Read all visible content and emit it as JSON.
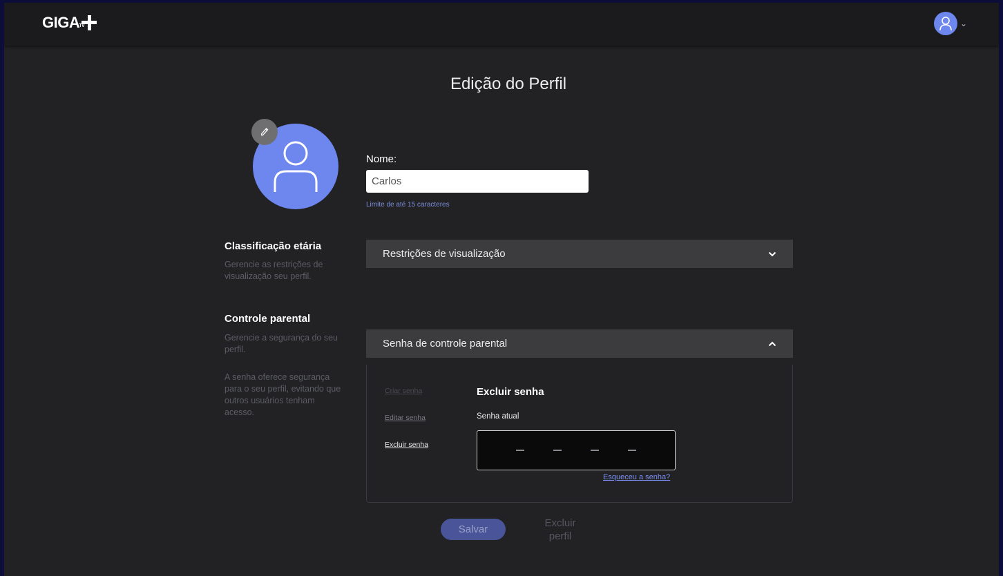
{
  "header": {
    "logo_text": "GIGA",
    "logo_sub": "TV",
    "account_caret": "⌄"
  },
  "page": {
    "title": "Edição do Perfil"
  },
  "profile": {
    "name_label": "Nome:",
    "name_value": "Carlos",
    "name_hint": "Limite de até 15 caracteres"
  },
  "age_rating": {
    "title": "Classificação etária",
    "description": "Gerencie as restrições de visualização seu perfil.",
    "accordion_label": "Restrições de visualização"
  },
  "parental": {
    "title": "Controle parental",
    "description": "Gerencie a segurança do seu perfil.",
    "note": "A senha oferece segurança para o seu perfil, evitando que outros usuários tenham acesso.",
    "accordion_label": "Senha de controle parental",
    "options": [
      {
        "label": "Criar senha",
        "color": "#4a4a52"
      },
      {
        "label": "Editar senha",
        "color": "#7a7a84"
      },
      {
        "label": "Excluir senha",
        "color": "#e8e8e8"
      }
    ],
    "panel_title": "Excluir senha",
    "current_password_label": "Senha atual",
    "forgot_link": "Esqueceu a senha?"
  },
  "actions": {
    "save": "Salvar",
    "delete_profile": "Excluir perfil"
  },
  "colors": {
    "accent": "#6d87ee",
    "background": "#222225",
    "header": "#1b1b1e",
    "link": "#7b8ff2"
  }
}
